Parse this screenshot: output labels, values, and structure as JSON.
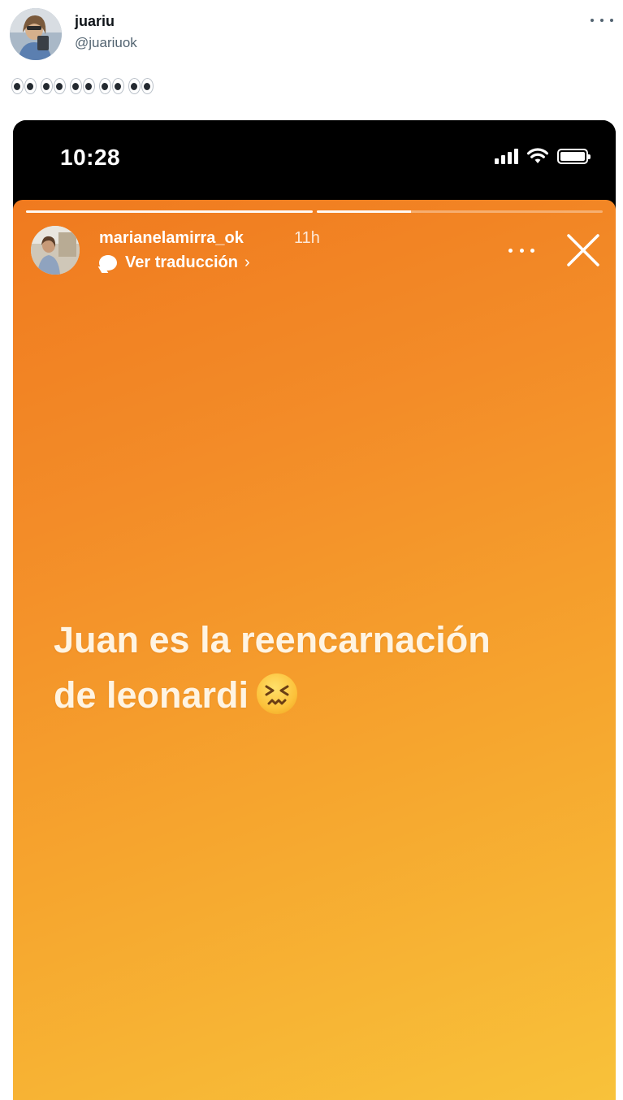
{
  "tweet": {
    "author": {
      "display_name": "juariu",
      "handle": "@juariuok",
      "avatar_icon": "profile-photo"
    },
    "more_icon": "more-dots-icon",
    "text_emoji": [
      "eyes",
      "eyes",
      "eyes",
      "eyes",
      "eyes"
    ]
  },
  "media": {
    "status_bar": {
      "time": "10:28",
      "icons": [
        "cellular-signal-icon",
        "wifi-icon",
        "battery-icon"
      ]
    },
    "story": {
      "username": "marianelamirra_ok",
      "time_ago": "11h",
      "translate_label": "Ver traducción",
      "translate_chevron": "›",
      "progress": [
        1.0,
        0.33
      ],
      "text_lines": [
        "Juan es la reencarnación",
        "de leonardi"
      ],
      "text_emoji": "confounded-face",
      "colors": {
        "gradient_start": "#f07a1f",
        "gradient_end": "#f8c23a",
        "text": "#fff4e2"
      }
    }
  }
}
